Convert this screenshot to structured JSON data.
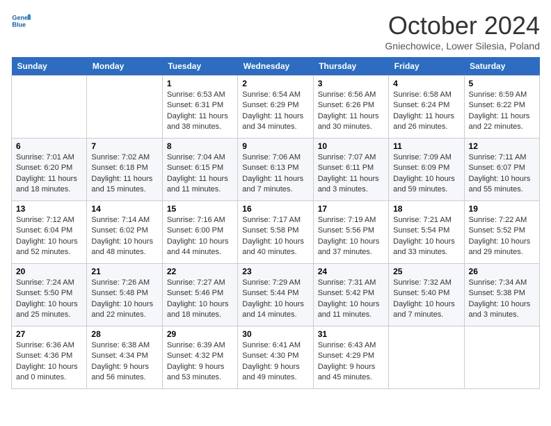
{
  "header": {
    "logo_line1": "General",
    "logo_line2": "Blue",
    "month_title": "October 2024",
    "location": "Gniechowice, Lower Silesia, Poland"
  },
  "days_of_week": [
    "Sunday",
    "Monday",
    "Tuesday",
    "Wednesday",
    "Thursday",
    "Friday",
    "Saturday"
  ],
  "weeks": [
    [
      {
        "day": "",
        "sunrise": "",
        "sunset": "",
        "daylight": ""
      },
      {
        "day": "",
        "sunrise": "",
        "sunset": "",
        "daylight": ""
      },
      {
        "day": "1",
        "sunrise": "Sunrise: 6:53 AM",
        "sunset": "Sunset: 6:31 PM",
        "daylight": "Daylight: 11 hours and 38 minutes."
      },
      {
        "day": "2",
        "sunrise": "Sunrise: 6:54 AM",
        "sunset": "Sunset: 6:29 PM",
        "daylight": "Daylight: 11 hours and 34 minutes."
      },
      {
        "day": "3",
        "sunrise": "Sunrise: 6:56 AM",
        "sunset": "Sunset: 6:26 PM",
        "daylight": "Daylight: 11 hours and 30 minutes."
      },
      {
        "day": "4",
        "sunrise": "Sunrise: 6:58 AM",
        "sunset": "Sunset: 6:24 PM",
        "daylight": "Daylight: 11 hours and 26 minutes."
      },
      {
        "day": "5",
        "sunrise": "Sunrise: 6:59 AM",
        "sunset": "Sunset: 6:22 PM",
        "daylight": "Daylight: 11 hours and 22 minutes."
      }
    ],
    [
      {
        "day": "6",
        "sunrise": "Sunrise: 7:01 AM",
        "sunset": "Sunset: 6:20 PM",
        "daylight": "Daylight: 11 hours and 18 minutes."
      },
      {
        "day": "7",
        "sunrise": "Sunrise: 7:02 AM",
        "sunset": "Sunset: 6:18 PM",
        "daylight": "Daylight: 11 hours and 15 minutes."
      },
      {
        "day": "8",
        "sunrise": "Sunrise: 7:04 AM",
        "sunset": "Sunset: 6:15 PM",
        "daylight": "Daylight: 11 hours and 11 minutes."
      },
      {
        "day": "9",
        "sunrise": "Sunrise: 7:06 AM",
        "sunset": "Sunset: 6:13 PM",
        "daylight": "Daylight: 11 hours and 7 minutes."
      },
      {
        "day": "10",
        "sunrise": "Sunrise: 7:07 AM",
        "sunset": "Sunset: 6:11 PM",
        "daylight": "Daylight: 11 hours and 3 minutes."
      },
      {
        "day": "11",
        "sunrise": "Sunrise: 7:09 AM",
        "sunset": "Sunset: 6:09 PM",
        "daylight": "Daylight: 10 hours and 59 minutes."
      },
      {
        "day": "12",
        "sunrise": "Sunrise: 7:11 AM",
        "sunset": "Sunset: 6:07 PM",
        "daylight": "Daylight: 10 hours and 55 minutes."
      }
    ],
    [
      {
        "day": "13",
        "sunrise": "Sunrise: 7:12 AM",
        "sunset": "Sunset: 6:04 PM",
        "daylight": "Daylight: 10 hours and 52 minutes."
      },
      {
        "day": "14",
        "sunrise": "Sunrise: 7:14 AM",
        "sunset": "Sunset: 6:02 PM",
        "daylight": "Daylight: 10 hours and 48 minutes."
      },
      {
        "day": "15",
        "sunrise": "Sunrise: 7:16 AM",
        "sunset": "Sunset: 6:00 PM",
        "daylight": "Daylight: 10 hours and 44 minutes."
      },
      {
        "day": "16",
        "sunrise": "Sunrise: 7:17 AM",
        "sunset": "Sunset: 5:58 PM",
        "daylight": "Daylight: 10 hours and 40 minutes."
      },
      {
        "day": "17",
        "sunrise": "Sunrise: 7:19 AM",
        "sunset": "Sunset: 5:56 PM",
        "daylight": "Daylight: 10 hours and 37 minutes."
      },
      {
        "day": "18",
        "sunrise": "Sunrise: 7:21 AM",
        "sunset": "Sunset: 5:54 PM",
        "daylight": "Daylight: 10 hours and 33 minutes."
      },
      {
        "day": "19",
        "sunrise": "Sunrise: 7:22 AM",
        "sunset": "Sunset: 5:52 PM",
        "daylight": "Daylight: 10 hours and 29 minutes."
      }
    ],
    [
      {
        "day": "20",
        "sunrise": "Sunrise: 7:24 AM",
        "sunset": "Sunset: 5:50 PM",
        "daylight": "Daylight: 10 hours and 25 minutes."
      },
      {
        "day": "21",
        "sunrise": "Sunrise: 7:26 AM",
        "sunset": "Sunset: 5:48 PM",
        "daylight": "Daylight: 10 hours and 22 minutes."
      },
      {
        "day": "22",
        "sunrise": "Sunrise: 7:27 AM",
        "sunset": "Sunset: 5:46 PM",
        "daylight": "Daylight: 10 hours and 18 minutes."
      },
      {
        "day": "23",
        "sunrise": "Sunrise: 7:29 AM",
        "sunset": "Sunset: 5:44 PM",
        "daylight": "Daylight: 10 hours and 14 minutes."
      },
      {
        "day": "24",
        "sunrise": "Sunrise: 7:31 AM",
        "sunset": "Sunset: 5:42 PM",
        "daylight": "Daylight: 10 hours and 11 minutes."
      },
      {
        "day": "25",
        "sunrise": "Sunrise: 7:32 AM",
        "sunset": "Sunset: 5:40 PM",
        "daylight": "Daylight: 10 hours and 7 minutes."
      },
      {
        "day": "26",
        "sunrise": "Sunrise: 7:34 AM",
        "sunset": "Sunset: 5:38 PM",
        "daylight": "Daylight: 10 hours and 3 minutes."
      }
    ],
    [
      {
        "day": "27",
        "sunrise": "Sunrise: 6:36 AM",
        "sunset": "Sunset: 4:36 PM",
        "daylight": "Daylight: 10 hours and 0 minutes."
      },
      {
        "day": "28",
        "sunrise": "Sunrise: 6:38 AM",
        "sunset": "Sunset: 4:34 PM",
        "daylight": "Daylight: 9 hours and 56 minutes."
      },
      {
        "day": "29",
        "sunrise": "Sunrise: 6:39 AM",
        "sunset": "Sunset: 4:32 PM",
        "daylight": "Daylight: 9 hours and 53 minutes."
      },
      {
        "day": "30",
        "sunrise": "Sunrise: 6:41 AM",
        "sunset": "Sunset: 4:30 PM",
        "daylight": "Daylight: 9 hours and 49 minutes."
      },
      {
        "day": "31",
        "sunrise": "Sunrise: 6:43 AM",
        "sunset": "Sunset: 4:29 PM",
        "daylight": "Daylight: 9 hours and 45 minutes."
      },
      {
        "day": "",
        "sunrise": "",
        "sunset": "",
        "daylight": ""
      },
      {
        "day": "",
        "sunrise": "",
        "sunset": "",
        "daylight": ""
      }
    ]
  ]
}
